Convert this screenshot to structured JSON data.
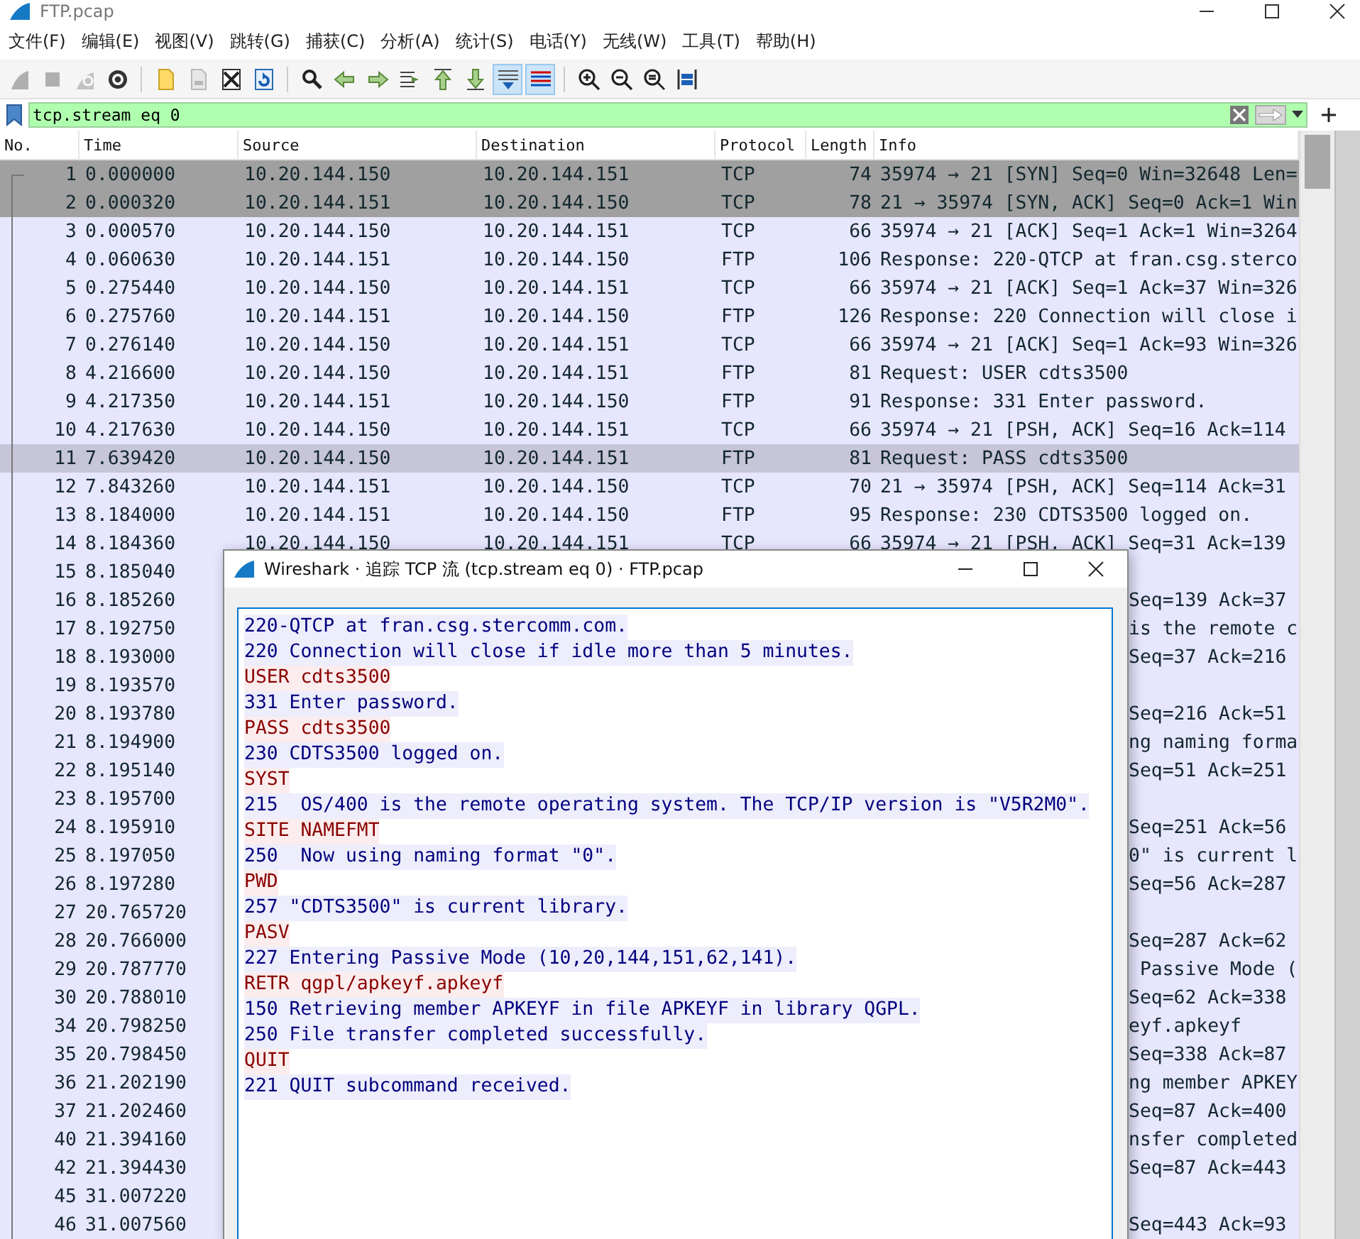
{
  "window": {
    "title": "FTP.pcap"
  },
  "menu": [
    "文件(F)",
    "编辑(E)",
    "视图(V)",
    "跳转(G)",
    "捕获(C)",
    "分析(A)",
    "统计(S)",
    "电话(Y)",
    "无线(W)",
    "工具(T)",
    "帮助(H)"
  ],
  "toolbar": [
    {
      "kind": "start",
      "on": false,
      "disabled": true
    },
    {
      "kind": "stop",
      "on": false,
      "disabled": true
    },
    {
      "kind": "restart",
      "on": false,
      "disabled": true
    },
    {
      "kind": "options",
      "on": false,
      "disabled": false
    },
    {
      "kind": "separator"
    },
    {
      "kind": "open",
      "on": false,
      "disabled": false
    },
    {
      "kind": "save",
      "on": false,
      "disabled": true
    },
    {
      "kind": "close",
      "on": false,
      "disabled": false
    },
    {
      "kind": "reload",
      "on": false,
      "disabled": false
    },
    {
      "kind": "separator"
    },
    {
      "kind": "find",
      "on": false,
      "disabled": false
    },
    {
      "kind": "back",
      "on": false,
      "disabled": false
    },
    {
      "kind": "forward",
      "on": false,
      "disabled": false
    },
    {
      "kind": "goto",
      "on": false,
      "disabled": false
    },
    {
      "kind": "first",
      "on": false,
      "disabled": false
    },
    {
      "kind": "last",
      "on": false,
      "disabled": false
    },
    {
      "kind": "autoscroll",
      "on": true,
      "disabled": false
    },
    {
      "kind": "colorize",
      "on": true,
      "disabled": false
    },
    {
      "kind": "separator"
    },
    {
      "kind": "zoom-in",
      "on": false,
      "disabled": false
    },
    {
      "kind": "zoom-out",
      "on": false,
      "disabled": false
    },
    {
      "kind": "zoom-reset",
      "on": false,
      "disabled": false
    },
    {
      "kind": "resize",
      "on": false,
      "disabled": false
    }
  ],
  "filter": {
    "value": "tcp.stream eq 0"
  },
  "table": {
    "columns": [
      "No.",
      "Time",
      "Source",
      "Destination",
      "Protocol",
      "Length",
      "Info"
    ],
    "rows": [
      {
        "kind": "full",
        "no": "1",
        "time": "0.000000",
        "source": "10.20.144.150",
        "destination": "10.20.144.151",
        "protocol": "TCP",
        "length": "74",
        "info": "35974 → 21 [SYN] Seq=0 Win=32648 Len=",
        "color": "#a0a0a0",
        "selected": false
      },
      {
        "kind": "full",
        "no": "2",
        "time": "0.000320",
        "source": "10.20.144.151",
        "destination": "10.20.144.150",
        "protocol": "TCP",
        "length": "78",
        "info": "21 → 35974 [SYN, ACK] Seq=0 Ack=1 Win",
        "color": "#a0a0a0",
        "selected": false
      },
      {
        "kind": "full",
        "no": "3",
        "time": "0.000570",
        "source": "10.20.144.150",
        "destination": "10.20.144.151",
        "protocol": "TCP",
        "length": "66",
        "info": "35974 → 21 [ACK] Seq=1 Ack=1 Win=3264",
        "color": "#e7e6ff",
        "selected": false
      },
      {
        "kind": "full",
        "no": "4",
        "time": "0.060630",
        "source": "10.20.144.151",
        "destination": "10.20.144.150",
        "protocol": "FTP",
        "length": "106",
        "info": "Response: 220-QTCP at fran.csg.sterco",
        "color": "#e7e6ff",
        "selected": false
      },
      {
        "kind": "full",
        "no": "5",
        "time": "0.275440",
        "source": "10.20.144.150",
        "destination": "10.20.144.151",
        "protocol": "TCP",
        "length": "66",
        "info": "35974 → 21 [ACK] Seq=1 Ack=37 Win=326",
        "color": "#e7e6ff",
        "selected": false
      },
      {
        "kind": "full",
        "no": "6",
        "time": "0.275760",
        "source": "10.20.144.151",
        "destination": "10.20.144.150",
        "protocol": "FTP",
        "length": "126",
        "info": "Response: 220 Connection will close i",
        "color": "#e7e6ff",
        "selected": false
      },
      {
        "kind": "full",
        "no": "7",
        "time": "0.276140",
        "source": "10.20.144.150",
        "destination": "10.20.144.151",
        "protocol": "TCP",
        "length": "66",
        "info": "35974 → 21 [ACK] Seq=1 Ack=93 Win=326",
        "color": "#e7e6ff",
        "selected": false
      },
      {
        "kind": "full",
        "no": "8",
        "time": "4.216600",
        "source": "10.20.144.150",
        "destination": "10.20.144.151",
        "protocol": "FTP",
        "length": "81",
        "info": "Request: USER cdts3500",
        "color": "#e7e6ff",
        "selected": false
      },
      {
        "kind": "full",
        "no": "9",
        "time": "4.217350",
        "source": "10.20.144.151",
        "destination": "10.20.144.150",
        "protocol": "FTP",
        "length": "91",
        "info": "Response: 331 Enter password.",
        "color": "#e7e6ff",
        "selected": false
      },
      {
        "kind": "full",
        "no": "10",
        "time": "4.217630",
        "source": "10.20.144.150",
        "destination": "10.20.144.151",
        "protocol": "TCP",
        "length": "66",
        "info": "35974 → 21 [PSH, ACK] Seq=16 Ack=114",
        "color": "#e7e6ff",
        "selected": false
      },
      {
        "kind": "full",
        "no": "11",
        "time": "7.639420",
        "source": "10.20.144.150",
        "destination": "10.20.144.151",
        "protocol": "FTP",
        "length": "81",
        "info": "Request: PASS cdts3500",
        "selected": true
      },
      {
        "kind": "full",
        "no": "12",
        "time": "7.843260",
        "source": "10.20.144.151",
        "destination": "10.20.144.150",
        "protocol": "TCP",
        "length": "70",
        "info": "21 → 35974 [PSH, ACK] Seq=114 Ack=31",
        "color": "#e7e6ff",
        "selected": false
      },
      {
        "kind": "full",
        "no": "13",
        "time": "8.184000",
        "source": "10.20.144.151",
        "destination": "10.20.144.150",
        "protocol": "FTP",
        "length": "95",
        "info": "Response: 230 CDTS3500 logged on.",
        "color": "#e7e6ff",
        "selected": false
      },
      {
        "kind": "full",
        "no": "14",
        "time": "8.184360",
        "source": "10.20.144.150",
        "destination": "10.20.144.151",
        "protocol": "TCP",
        "length": "66",
        "info": "35974 → 21 [PSH, ACK] Seq=31 Ack=139",
        "color": "#e7e6ff",
        "selected": false
      },
      {
        "kind": "covered",
        "no": "15",
        "time": "8.185040",
        "color": "#e7e6ff",
        "selected": false
      },
      {
        "kind": "covered",
        "no": "16",
        "time": "8.185260",
        "info_tail": "Seq=139 Ack=37",
        "color": "#e7e6ff",
        "selected": false
      },
      {
        "kind": "covered",
        "no": "17",
        "time": "8.192750",
        "info_tail": "is the remote c",
        "color": "#e7e6ff",
        "selected": false
      },
      {
        "kind": "covered",
        "no": "18",
        "time": "8.193000",
        "info_tail": "Seq=37 Ack=216",
        "color": "#e7e6ff",
        "selected": false
      },
      {
        "kind": "covered",
        "no": "19",
        "time": "8.193570",
        "color": "#e7e6ff",
        "selected": false
      },
      {
        "kind": "covered",
        "no": "20",
        "time": "8.193780",
        "info_tail": "Seq=216 Ack=51",
        "color": "#e7e6ff",
        "selected": false
      },
      {
        "kind": "covered",
        "no": "21",
        "time": "8.194900",
        "info_tail": "ng naming forma",
        "color": "#e7e6ff",
        "selected": false
      },
      {
        "kind": "covered",
        "no": "22",
        "time": "8.195140",
        "info_tail": "Seq=51 Ack=251",
        "color": "#e7e6ff",
        "selected": false
      },
      {
        "kind": "covered",
        "no": "23",
        "time": "8.195700",
        "color": "#e7e6ff",
        "selected": false
      },
      {
        "kind": "covered",
        "no": "24",
        "time": "8.195910",
        "info_tail": "Seq=251 Ack=56",
        "color": "#e7e6ff",
        "selected": false
      },
      {
        "kind": "covered",
        "no": "25",
        "time": "8.197050",
        "info_tail": "0\" is current l",
        "color": "#e7e6ff",
        "selected": false
      },
      {
        "kind": "covered",
        "no": "26",
        "time": "8.197280",
        "info_tail": "Seq=56 Ack=287",
        "color": "#e7e6ff",
        "selected": false
      },
      {
        "kind": "covered",
        "no": "27",
        "time": "20.765720",
        "color": "#e7e6ff",
        "selected": false
      },
      {
        "kind": "covered",
        "no": "28",
        "time": "20.766000",
        "info_tail": "Seq=287 Ack=62",
        "color": "#e7e6ff",
        "selected": false
      },
      {
        "kind": "covered",
        "no": "29",
        "time": "20.787770",
        "info_tail": " Passive Mode (",
        "color": "#e7e6ff",
        "selected": false
      },
      {
        "kind": "covered",
        "no": "30",
        "time": "20.788010",
        "info_tail": "Seq=62 Ack=338",
        "color": "#e7e6ff",
        "selected": false
      },
      {
        "kind": "covered",
        "no": "34",
        "time": "20.798250",
        "info_tail": "eyf.apkeyf",
        "color": "#e7e6ff",
        "selected": false
      },
      {
        "kind": "covered",
        "no": "35",
        "time": "20.798450",
        "info_tail": "Seq=338 Ack=87",
        "color": "#e7e6ff",
        "selected": false
      },
      {
        "kind": "covered",
        "no": "36",
        "time": "21.202190",
        "info_tail": "ng member APKEY",
        "color": "#e7e6ff",
        "selected": false
      },
      {
        "kind": "covered",
        "no": "37",
        "time": "21.202460",
        "info_tail": "Seq=87 Ack=400",
        "color": "#e7e6ff",
        "selected": false
      },
      {
        "kind": "covered",
        "no": "40",
        "time": "21.394160",
        "info_tail": "nsfer completed",
        "color": "#e7e6ff",
        "selected": false
      },
      {
        "kind": "covered",
        "no": "42",
        "time": "21.394430",
        "info_tail": "Seq=87 Ack=443",
        "color": "#e7e6ff",
        "selected": false
      },
      {
        "kind": "covered",
        "no": "45",
        "time": "31.007220",
        "color": "#e7e6ff",
        "selected": false
      },
      {
        "kind": "covered",
        "no": "46",
        "time": "31.007560",
        "info_tail": "Seq=443 Ack=93",
        "color": "#e7e6ff",
        "selected": false
      }
    ]
  },
  "dialog": {
    "title": "Wireshark · 追踪 TCP 流 (tcp.stream eq 0) · FTP.pcap",
    "lines": [
      {
        "kind": "server",
        "text": "220-QTCP at fran.csg.stercomm.com."
      },
      {
        "kind": "server",
        "text": "220 Connection will close if idle more than 5 minutes."
      },
      {
        "kind": "client",
        "text": "USER cdts3500"
      },
      {
        "kind": "server",
        "text": "331 Enter password."
      },
      {
        "kind": "client",
        "text": "PASS cdts3500"
      },
      {
        "kind": "server",
        "text": "230 CDTS3500 logged on."
      },
      {
        "kind": "client",
        "text": "SYST"
      },
      {
        "kind": "server",
        "text": "215  OS/400 is the remote operating system. The TCP/IP version is \"V5R2M0\"."
      },
      {
        "kind": "client",
        "text": "SITE NAMEFMT"
      },
      {
        "kind": "server",
        "text": "250  Now using naming format \"0\"."
      },
      {
        "kind": "client",
        "text": "PWD"
      },
      {
        "kind": "server",
        "text": "257 \"CDTS3500\" is current library."
      },
      {
        "kind": "client",
        "text": "PASV"
      },
      {
        "kind": "server",
        "text": "227 Entering Passive Mode (10,20,144,151,62,141)."
      },
      {
        "kind": "client",
        "text": "RETR qgpl/apkeyf.apkeyf"
      },
      {
        "kind": "server",
        "text": "150 Retrieving member APKEYF in file APKEYF in library QGPL."
      },
      {
        "kind": "server",
        "text": "250 File transfer completed successfully."
      },
      {
        "kind": "client",
        "text": "QUIT"
      },
      {
        "kind": "server",
        "text": "221 QUIT subcommand received."
      }
    ]
  }
}
